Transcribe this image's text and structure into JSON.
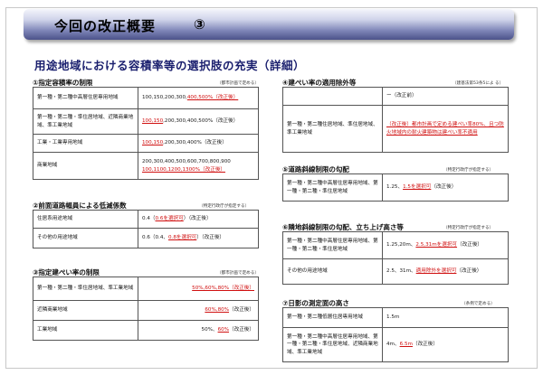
{
  "title": {
    "main": "今回の改正概要",
    "num": "③"
  },
  "subtitle": "用途地域における容積率等の選択肢の充実（詳細）",
  "s1": {
    "head": "①指定容積率の制限",
    "note": "（都市計画で定める）",
    "rows": [
      {
        "k": "第一種・第二種中高層住居専用地域",
        "v1": "100,150,200,300,",
        "v2": "400,500%（改正後）",
        "v3": ""
      },
      {
        "k": "第一種・第二種・準住居地域、近隣商業地域、準工業地域",
        "v1": "",
        "v2": "100,150",
        "v3": ",200,300,400,500%（改正後）"
      },
      {
        "k": "工業・工業専用地域",
        "v1": "",
        "v2": "100,150",
        "v3": ",200,300,400%（改正後）"
      },
      {
        "k": "商業地域",
        "v1": "200,300,400,500,600,700,800,900",
        "v2": "100,1100,1200,1300%（改正後）",
        "v3": ""
      }
    ]
  },
  "s2": {
    "head": "②前面道路幅員による低減係数",
    "note": "（特定行政庁が指定する）",
    "rows": [
      {
        "k": "住居系用途地域",
        "v1": "0.4（",
        "v2": "0.6を選択可",
        "v3": "）（改正後）"
      },
      {
        "k": "その他の用途地域",
        "v1": "0.6（0.4、",
        "v2": "0.8を選択可",
        "v3": "）（改正後）"
      }
    ]
  },
  "s3": {
    "head": "③指定建ぺい率の制限",
    "note": "（都市計画で定める）",
    "rows": [
      {
        "k": "第一種・第二種・準住居地域、準工業地域",
        "v1": "",
        "v2": "50%,60%,80%（改正後）",
        "v3": ""
      },
      {
        "k": "近隣商業地域",
        "v1": "",
        "v2": "60%,80%",
        "v3": "（改正後）"
      },
      {
        "k": "工業地域",
        "v1": "50%、",
        "v2": "60%",
        "v3": "（改正後）"
      }
    ]
  },
  "s4": {
    "head": "④建ぺい率の適用除外等",
    "note": "（建基法第53条5によ る）",
    "rows": [
      {
        "k": "",
        "v1": "ー（改正前）",
        "v2": "",
        "v3": ""
      },
      {
        "k": "第一種・第二種住居地域、準住居地域、準工業地域",
        "v1": "",
        "v2": "（改正後）都市計画で定める建ぺい率80%、且つ防火地域内の耐火建築物は建ぺい率不適用",
        "v3": ""
      }
    ]
  },
  "s5": {
    "head": "⑤道路斜線制限の勾配",
    "note": "（特定行政庁が指定する）",
    "rows": [
      {
        "k": "第一種・第二種中高層住居専用地域、第一種・第二種・準住居地域",
        "v1": "1.25、",
        "v2": "1.5を選択可",
        "v3": "（改正後）"
      }
    ]
  },
  "s6": {
    "head": "⑥隣地斜線制限の勾配、立ち上げ高さ等",
    "note": "（特定行政庁が指定する）",
    "rows": [
      {
        "k": "第一種・第二種中高層住居専用地域、第一種・第二種・準住居地域",
        "v1": "1.25,20m、",
        "v2": "2.5,31mを選択可",
        "v3": "（改正後）"
      },
      {
        "k": "その他の用途地域",
        "v1": "2.5、31m、",
        "v2": "適用除外を選択可",
        "v3": "（改正後）"
      }
    ]
  },
  "s7": {
    "head": "⑦日影の測定面の高さ",
    "note": "（条例で定める）",
    "rows": [
      {
        "k": "第一種・第二種低層住居専用地域",
        "v1": "1.5m",
        "v2": "",
        "v3": ""
      },
      {
        "k": "第一種・第二種中高層住居専用地域、第一種・第二種・準住居地域、近隣商業地域、準工業地域",
        "v1": "4m、",
        "v2": "6.5m",
        "v3": "（改正後）"
      }
    ]
  }
}
